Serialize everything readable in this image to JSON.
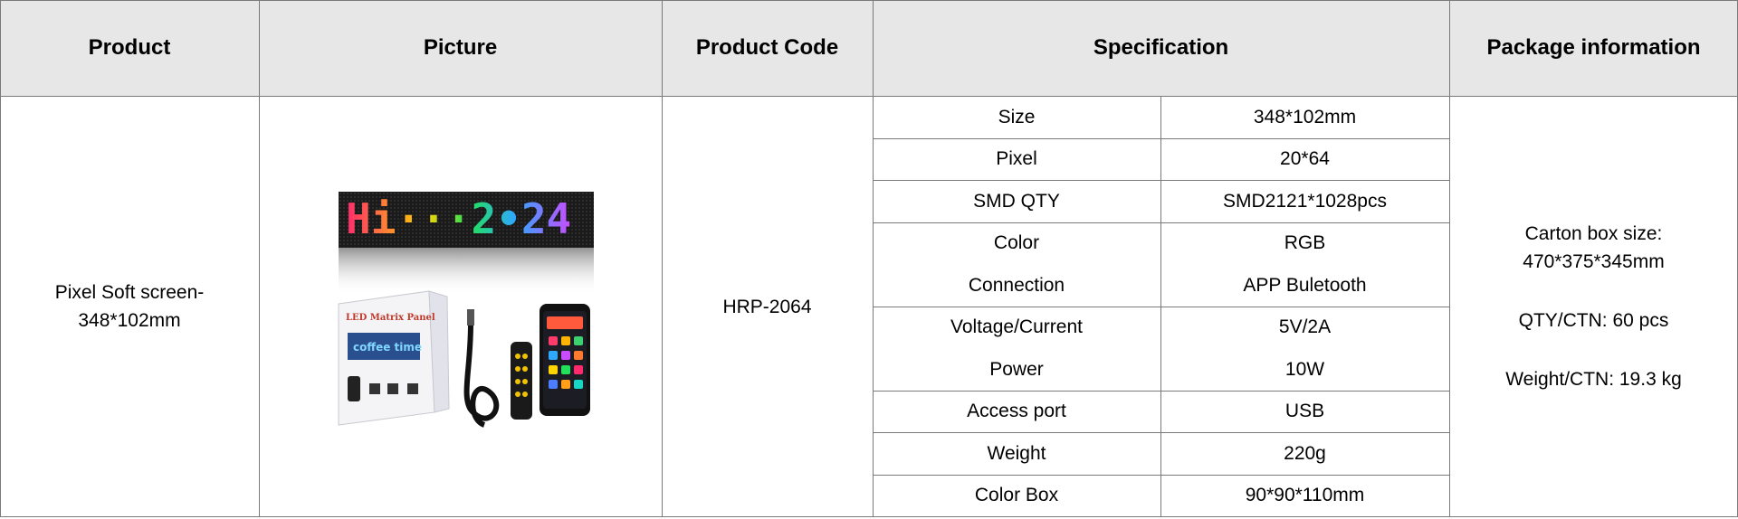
{
  "headers": {
    "product": "Product",
    "picture": "Picture",
    "product_code": "Product Code",
    "specification": "Specification",
    "package": "Package information"
  },
  "product": {
    "name_line1": "Pixel Soft screen-",
    "name_line2": "348*102mm",
    "code": "HRP-2064"
  },
  "picture": {
    "led_text": "Hi···2•24",
    "box_title": "LED Matrix Panel",
    "box_screen_text": "coffee time"
  },
  "specs": [
    {
      "label": "Size",
      "value": "348*102mm"
    },
    {
      "label": "Pixel",
      "value": "20*64"
    },
    {
      "label": "SMD QTY",
      "value": "SMD2121*1028pcs"
    },
    {
      "label": "Color",
      "value": "RGB"
    },
    {
      "label": "Connection",
      "value": "APP Buletooth"
    },
    {
      "label": "Voltage/Current",
      "value": "5V/2A"
    },
    {
      "label": "Power",
      "value": "10W"
    },
    {
      "label": "Access port",
      "value": "USB"
    },
    {
      "label": "Weight",
      "value": "220g"
    },
    {
      "label": "Color Box",
      "value": "90*90*110mm"
    }
  ],
  "package": {
    "carton_line1": "Carton box size:",
    "carton_line2": "470*375*345mm",
    "qty": "QTY/CTN: 60 pcs",
    "weight": "Weight/CTN: 19.3 kg"
  },
  "colors": {
    "header_bg": "#e7e7e7",
    "grid": "#7a7a7a"
  }
}
